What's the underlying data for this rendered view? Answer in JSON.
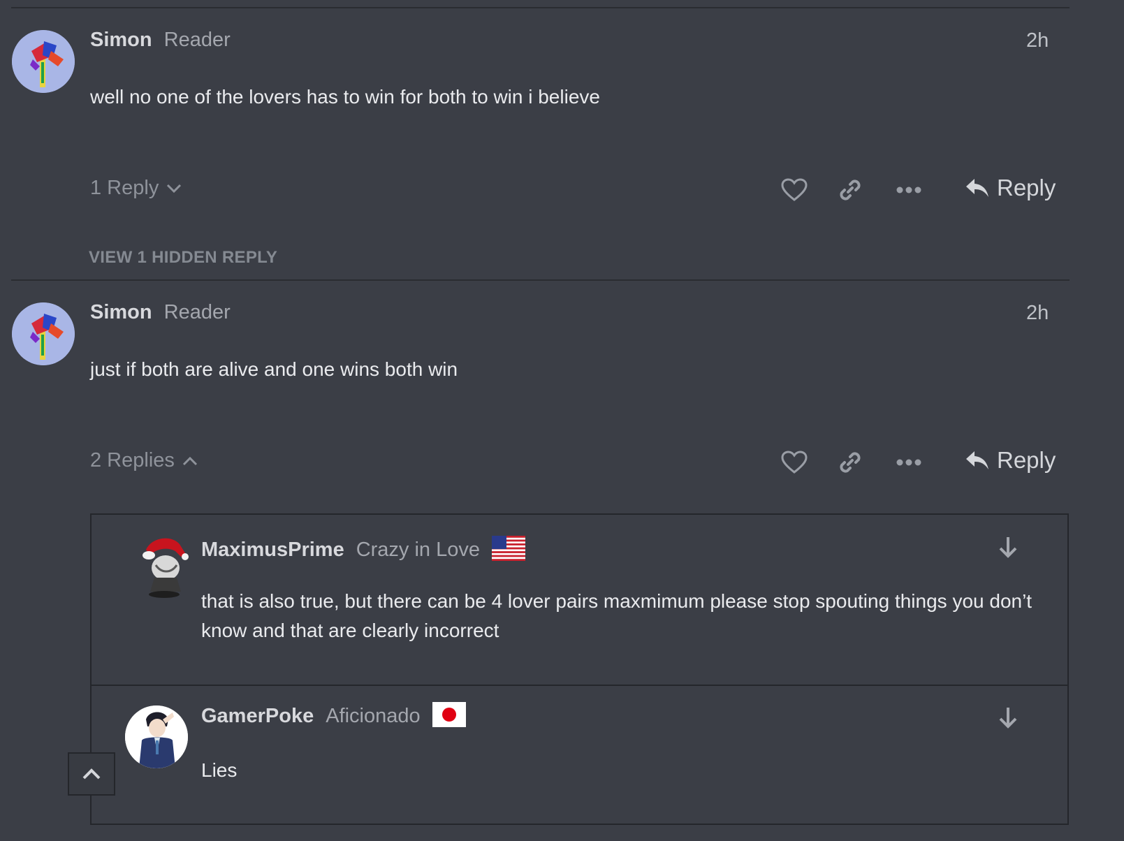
{
  "comments": [
    {
      "author": "Simon",
      "role": "Reader",
      "time": "2h",
      "text": "well no one of the lovers has to win for both to win i believe",
      "replies_label": "1 Reply",
      "reply_label": "Reply",
      "hidden_replies_link": "VIEW 1 HIDDEN REPLY"
    },
    {
      "author": "Simon",
      "role": "Reader",
      "time": "2h",
      "text": "just if both are alive and one wins both win",
      "replies_label": "2 Replies",
      "reply_label": "Reply",
      "replies": [
        {
          "author": "MaximusPrime",
          "role": "Crazy in Love",
          "flag": "us-flag-icon",
          "text": "that is also true, but there can be 4 lover pairs maxmimum please stop spouting things you don’t know and that are clearly incorrect"
        },
        {
          "author": "GamerPoke",
          "role": "Aficionado",
          "flag": "japan-flag-icon",
          "text": "Lies"
        }
      ]
    }
  ],
  "colors": {
    "background": "#3b3e46",
    "divider": "#2a2c31",
    "muted_text": "#8f939b",
    "body_text": "#eaebee"
  }
}
